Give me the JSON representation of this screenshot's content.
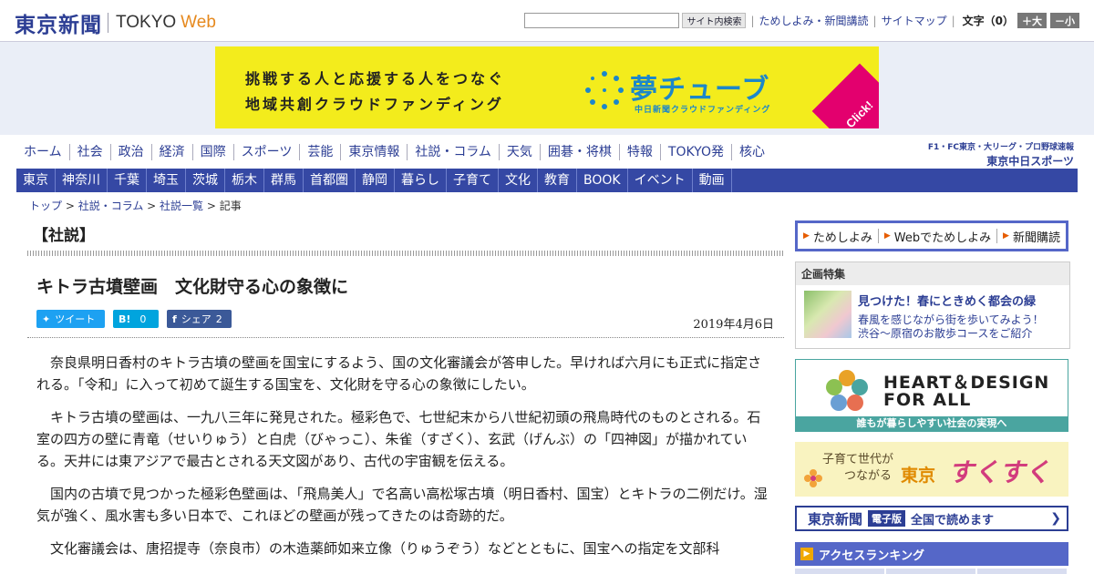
{
  "header": {
    "logo_jp": "東京新聞",
    "logo_en": "TOKYO",
    "logo_web": "Web",
    "search_placeholder": "",
    "search_button": "サイト内検索",
    "links": [
      "ためしよみ・新聞講読",
      "サイトマップ"
    ],
    "font_size_label": "文字（0）",
    "size_up": "＋大",
    "size_down": "－小"
  },
  "banner": {
    "line1": "挑戦する人と応援する人をつなぐ",
    "line2": "地域共創クラウドファンディング",
    "brand": "夢チューブ",
    "sub": "中日新聞クラウドファンディング",
    "click": "Click!",
    "colors": {
      "background": "#f3ec1c",
      "brand": "#1c87c9",
      "click": "#e3006e"
    }
  },
  "nav": {
    "primary": [
      "ホーム",
      "社会",
      "政治",
      "経済",
      "国際",
      "スポーツ",
      "芸能",
      "東京情報",
      "社説・コラム",
      "天気",
      "囲碁・将棋",
      "特報",
      "TOKYO発",
      "核心"
    ],
    "chunichi_top": "F1・FC東京・大リーグ・プロ野球速報",
    "chunichi_bottom": "東京中日スポーツ",
    "secondary": [
      "東京",
      "神奈川",
      "千葉",
      "埼玉",
      "茨城",
      "栃木",
      "群馬",
      "首都圏",
      "静岡",
      "暮らし",
      "子育て",
      "文化",
      "教育",
      "BOOK",
      "イベント",
      "動画"
    ]
  },
  "breadcrumb": {
    "items": [
      "トップ",
      "社説・コラム",
      "社説一覧"
    ],
    "separator": " > ",
    "current": "記事"
  },
  "article": {
    "section": "【社説】",
    "title": "キトラ古墳壁画　文化財守る心の象徴に",
    "date": "2019年4月6日",
    "share": {
      "twitter_label": "ツイート",
      "hatena_label": "B!",
      "hatena_count": "0",
      "facebook_label": "シェア",
      "facebook_count": "2"
    },
    "paragraphs": [
      "奈良県明日香村のキトラ古墳の壁画を国宝にするよう、国の文化審議会が答申した。早ければ六月にも正式に指定される。「令和」に入って初めて誕生する国宝を、文化財を守る心の象徴にしたい。",
      "キトラ古墳の壁画は、一九八三年に発見された。極彩色で、七世紀末から八世紀初頭の飛鳥時代のものとされる。石室の四方の壁に青竜（せいりゅう）と白虎（びゃっこ）、朱雀（すざく）、玄武（げんぶ）の「四神図」が描かれている。天井には東アジアで最古とされる天文図があり、古代の宇宙観を伝える。",
      "国内の古墳で見つかった極彩色壁画は、「飛鳥美人」で名高い高松塚古墳（明日香村、国宝）とキトラの二例だけ。湿気が強く、風水害も多い日本で、これほどの壁画が残ってきたのは奇跡的だ。",
      "文化審議会は、唐招提寺（奈良市）の木造薬師如来立像（りゅうぞう）などとともに、国宝への指定を文部科"
    ]
  },
  "sidebar": {
    "cta": [
      "ためしよみ",
      "Webでためしよみ",
      "新聞購読"
    ],
    "feature": {
      "heading": "企画特集",
      "title": "見つけた！春にときめく都会の緑",
      "desc_line1": "春風を感じながら街を歩いてみよう！",
      "desc_line2": "渋谷～原宿のお散歩コースをご紹介"
    },
    "heart_design": {
      "title_line1": "HEART＆DESIGN",
      "title_line2": "FOR ALL",
      "caption": "誰もが暮らしやすい社会の実現へ"
    },
    "sukusuku": {
      "line1": "子育て世代が",
      "line2": "つながる",
      "brand1": "東京",
      "brand2": "すくすく"
    },
    "denshi": {
      "logo": "東京新聞",
      "tag": "電子版",
      "text": "全国で読めます"
    },
    "ranking": {
      "title": "アクセスランキング"
    }
  }
}
